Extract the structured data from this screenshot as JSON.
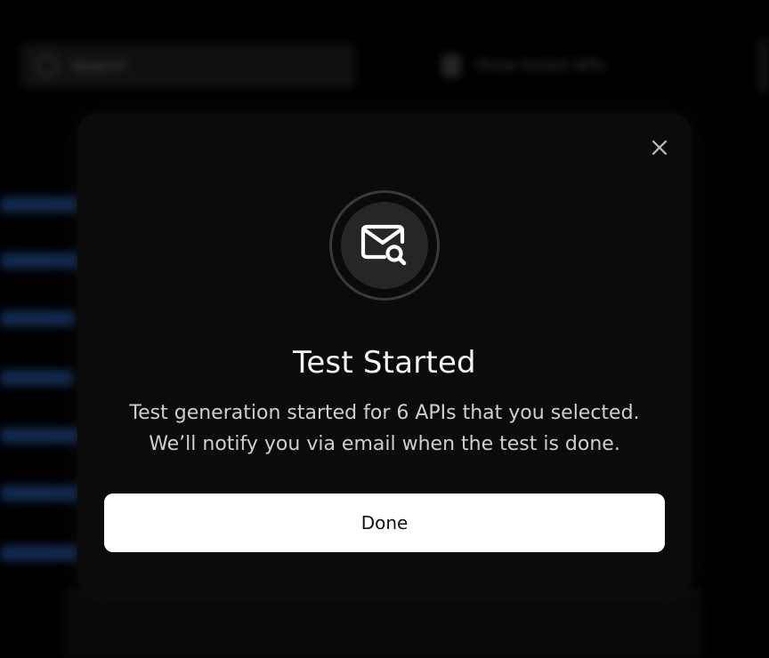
{
  "background": {
    "search_placeholder": "Search",
    "toggle_label": "Show tested APIs"
  },
  "modal": {
    "close_icon": "close-icon",
    "header_icon": "mail-search-icon",
    "title": "Test Started",
    "message_line_1": "Test generation started for  6 APIs that you selected.",
    "message_line_2": "We’ll notify you via email when the test is done.",
    "done_label": "Done"
  },
  "colors": {
    "overlay_background": "#000000",
    "modal_background": "#0b0b0b",
    "button_background": "#ffffff",
    "title_color": "#f5f5f5",
    "message_color": "#cfcfcf"
  }
}
